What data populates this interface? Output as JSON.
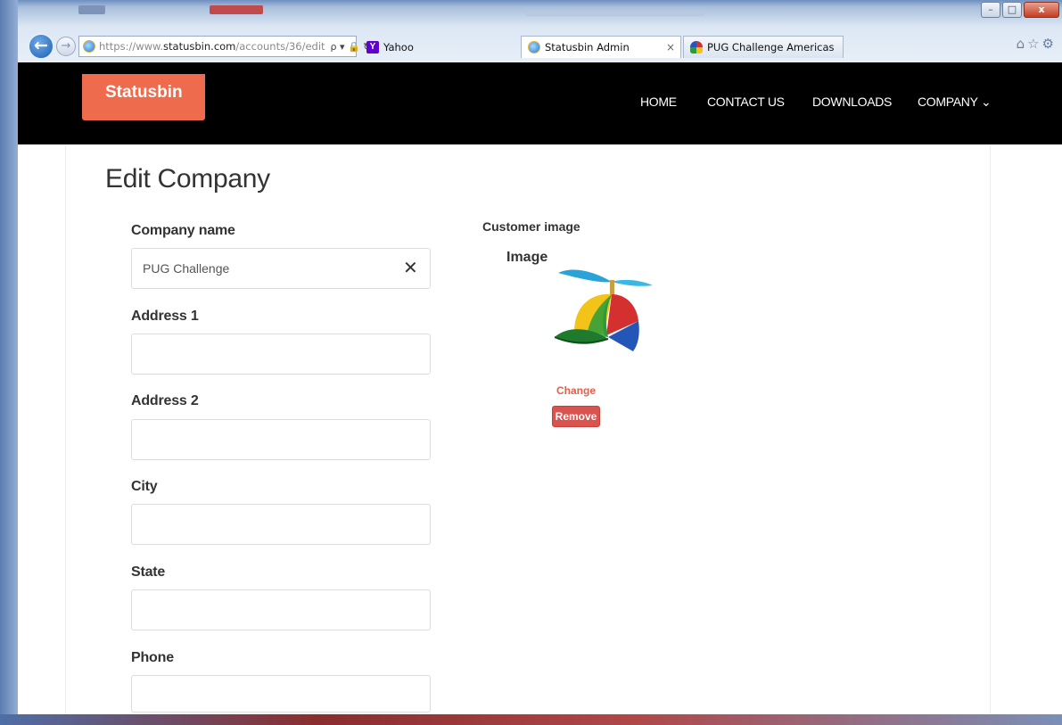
{
  "browser": {
    "url_prefix": "https://www.",
    "url_domain": "statusbin.com",
    "url_path": "/accounts/36/edit",
    "url_tools": "ρ ▾ 🔒 ↻",
    "tabs": [
      {
        "label": "Yahoo",
        "favicon": "yahoo-icon",
        "active": false
      },
      {
        "label": "Statusbin Admin",
        "favicon": "ie-icon",
        "active": true
      },
      {
        "label": "PUG Challenge Americas",
        "favicon": "pug-cap-icon",
        "active": false
      }
    ],
    "tab_close_glyph": "×",
    "window_buttons": {
      "minimize": "–",
      "maximize": "□",
      "close": "x"
    },
    "right_icons": "⌂☆⚙"
  },
  "navbar": {
    "brand": "Statusbin",
    "brand_color": "#ee6b4d",
    "links": [
      {
        "label": "HOME"
      },
      {
        "label": "CONTACT US"
      },
      {
        "label": "DOWNLOADS"
      },
      {
        "label": "COMPANY ⌄"
      }
    ]
  },
  "page": {
    "title": "Edit Company"
  },
  "form": {
    "fields": [
      {
        "label": "Company name",
        "value": "PUG Challenge"
      },
      {
        "label": "Address 1",
        "value": ""
      },
      {
        "label": "Address 2",
        "value": ""
      },
      {
        "label": "City",
        "value": ""
      },
      {
        "label": "State",
        "value": ""
      },
      {
        "label": "Phone",
        "value": ""
      }
    ],
    "clear_glyph": "✕"
  },
  "customer_image": {
    "section_label": "Customer image",
    "image_label": "Image",
    "image_icon": "propeller-cap-icon",
    "change_label": "Change",
    "remove_label": "Remove",
    "remove_color": "#d9534f"
  }
}
